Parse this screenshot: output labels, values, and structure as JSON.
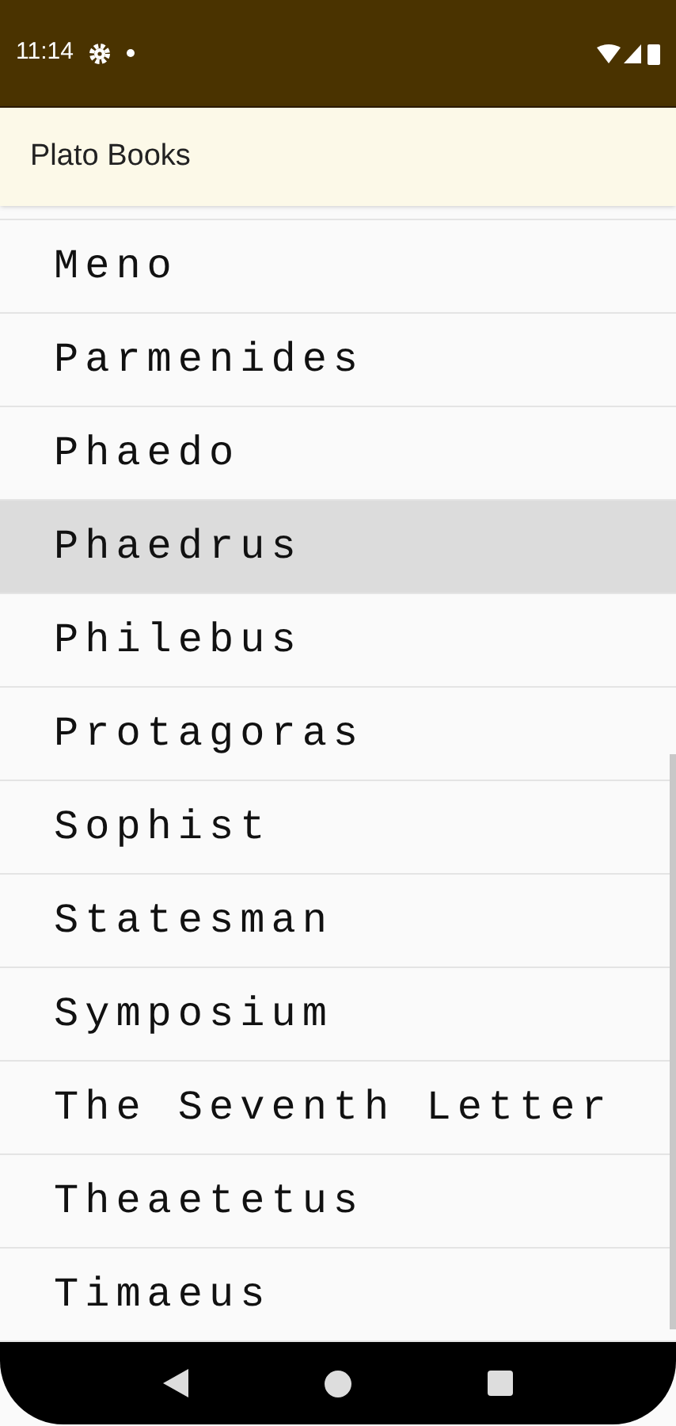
{
  "status_bar": {
    "time": "11:14"
  },
  "app_bar": {
    "title": "Plato Books"
  },
  "books": [
    {
      "title": "Meno",
      "selected": false
    },
    {
      "title": "Parmenides",
      "selected": false
    },
    {
      "title": "Phaedo",
      "selected": false
    },
    {
      "title": "Phaedrus",
      "selected": true
    },
    {
      "title": "Philebus",
      "selected": false
    },
    {
      "title": "Protagoras",
      "selected": false
    },
    {
      "title": "Sophist",
      "selected": false
    },
    {
      "title": "Statesman",
      "selected": false
    },
    {
      "title": "Symposium",
      "selected": false
    },
    {
      "title": "The Seventh Letter",
      "selected": false
    },
    {
      "title": "Theaetetus",
      "selected": false
    },
    {
      "title": "Timaeus",
      "selected": false
    }
  ]
}
